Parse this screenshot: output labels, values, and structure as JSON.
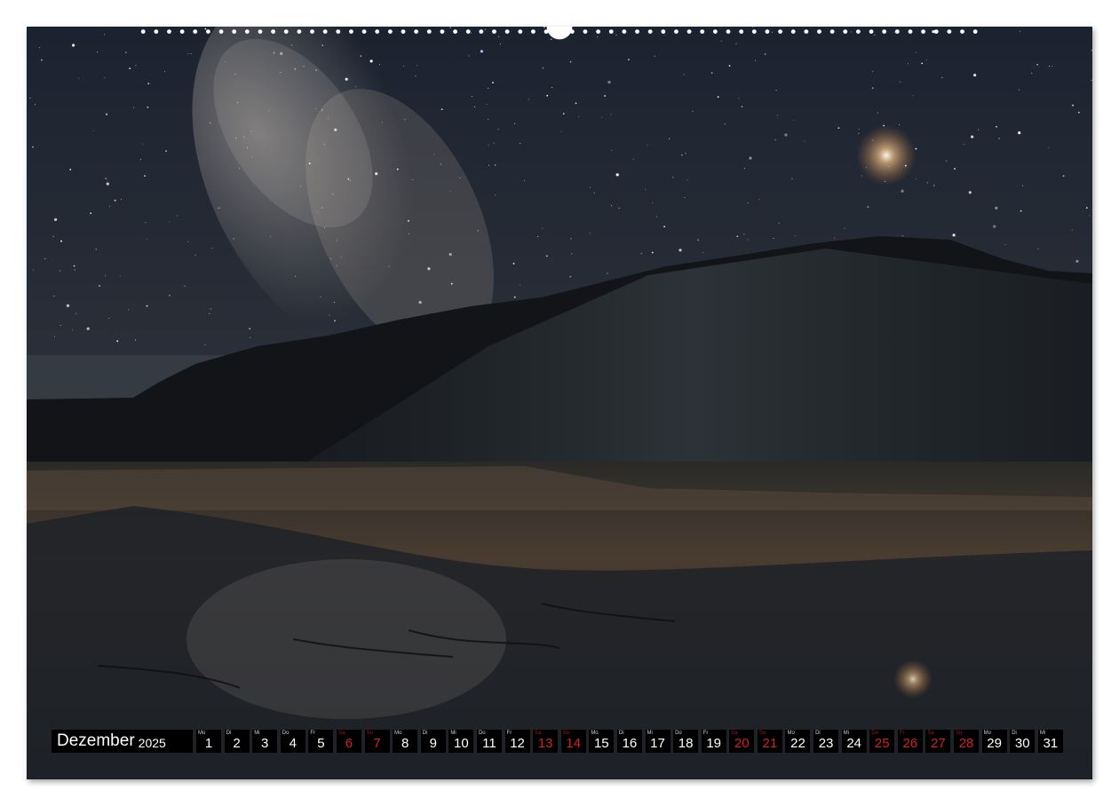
{
  "calendar": {
    "month": "Dezember",
    "year": "2025",
    "days": [
      {
        "wd": "Mo",
        "d": "1",
        "we": false
      },
      {
        "wd": "Di",
        "d": "2",
        "we": false
      },
      {
        "wd": "Mi",
        "d": "3",
        "we": false
      },
      {
        "wd": "Do",
        "d": "4",
        "we": false
      },
      {
        "wd": "Fr",
        "d": "5",
        "we": false
      },
      {
        "wd": "Sa",
        "d": "6",
        "we": true
      },
      {
        "wd": "So",
        "d": "7",
        "we": true
      },
      {
        "wd": "Mo",
        "d": "8",
        "we": false
      },
      {
        "wd": "Di",
        "d": "9",
        "we": false
      },
      {
        "wd": "Mi",
        "d": "10",
        "we": false
      },
      {
        "wd": "Do",
        "d": "11",
        "we": false
      },
      {
        "wd": "Fr",
        "d": "12",
        "we": false
      },
      {
        "wd": "Sa",
        "d": "13",
        "we": true
      },
      {
        "wd": "So",
        "d": "14",
        "we": true
      },
      {
        "wd": "Mo",
        "d": "15",
        "we": false
      },
      {
        "wd": "Di",
        "d": "16",
        "we": false
      },
      {
        "wd": "Mi",
        "d": "17",
        "we": false
      },
      {
        "wd": "Do",
        "d": "18",
        "we": false
      },
      {
        "wd": "Fr",
        "d": "19",
        "we": false
      },
      {
        "wd": "Sa",
        "d": "20",
        "we": true
      },
      {
        "wd": "So",
        "d": "21",
        "we": true
      },
      {
        "wd": "Mo",
        "d": "22",
        "we": false
      },
      {
        "wd": "Di",
        "d": "23",
        "we": false
      },
      {
        "wd": "Mi",
        "d": "24",
        "we": false
      },
      {
        "wd": "Do",
        "d": "25",
        "we": true
      },
      {
        "wd": "Fr",
        "d": "26",
        "we": true
      },
      {
        "wd": "Sa",
        "d": "27",
        "we": true
      },
      {
        "wd": "So",
        "d": "28",
        "we": true
      },
      {
        "wd": "Mo",
        "d": "29",
        "we": false
      },
      {
        "wd": "Di",
        "d": "30",
        "we": false
      },
      {
        "wd": "Mi",
        "d": "31",
        "we": false
      }
    ]
  },
  "colors": {
    "weekend": "#d21f2a",
    "bar_bg": "#000000",
    "sky": "#1a2230",
    "glow": "#f3c48a"
  }
}
